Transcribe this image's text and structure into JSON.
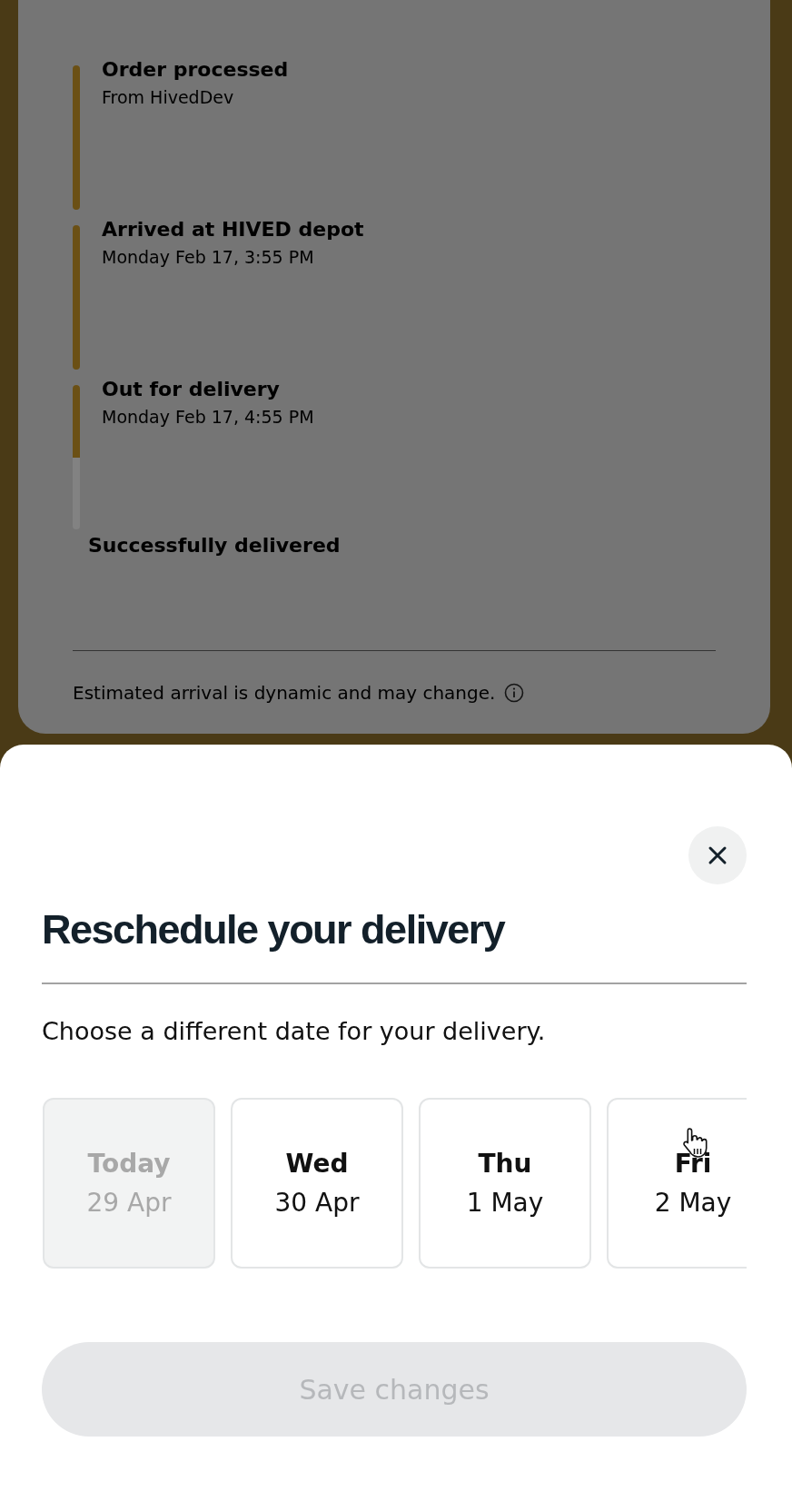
{
  "tracking": {
    "steps": [
      {
        "title": "Order processed",
        "detail": "From HivedDev",
        "level": 1
      },
      {
        "title": "Arrived at HIVED depot",
        "detail": "Monday Feb 17, 3:55 PM",
        "level": 1
      },
      {
        "title": "Out for delivery",
        "detail": "Monday Feb 17, 4:55 PM",
        "level": 0.5
      }
    ],
    "final_step": "Successfully delivered",
    "note": "Estimated arrival is dynamic and may change."
  },
  "sheet": {
    "title": "Reschedule your delivery",
    "subtitle": "Choose a different date for your delivery.",
    "dates": [
      {
        "day": "Today",
        "date": "29 Apr",
        "disabled": true,
        "selected": false
      },
      {
        "day": "Wed",
        "date": "30 Apr",
        "disabled": false,
        "selected": false
      },
      {
        "day": "Thu",
        "date": "1 May",
        "disabled": false,
        "selected": false
      },
      {
        "day": "Fri",
        "date": "2 May",
        "disabled": false,
        "selected": false
      }
    ],
    "save_button": {
      "label": "Save changes",
      "disabled": true
    }
  }
}
